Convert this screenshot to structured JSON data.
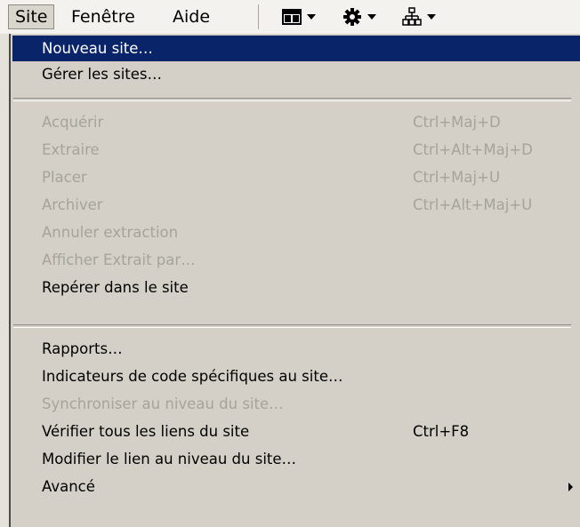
{
  "menubar": {
    "items": [
      "Site",
      "Fenêtre",
      "Aide"
    ]
  },
  "toolbar": {
    "icons": [
      "layout-icon",
      "gear-icon",
      "site-map-icon"
    ]
  },
  "menu": {
    "items": [
      {
        "label": "Nouveau site…",
        "shortcut": "",
        "state": "highlighted"
      },
      {
        "label": "Gérer les sites…",
        "shortcut": "",
        "state": "enabled"
      },
      {
        "label": "Acquérir",
        "shortcut": "Ctrl+Maj+D",
        "state": "disabled"
      },
      {
        "label": "Extraire",
        "shortcut": "Ctrl+Alt+Maj+D",
        "state": "disabled"
      },
      {
        "label": "Placer",
        "shortcut": "Ctrl+Maj+U",
        "state": "disabled"
      },
      {
        "label": "Archiver",
        "shortcut": "Ctrl+Alt+Maj+U",
        "state": "disabled"
      },
      {
        "label": "Annuler extraction",
        "shortcut": "",
        "state": "disabled"
      },
      {
        "label": "Afficher Extrait par…",
        "shortcut": "",
        "state": "disabled"
      },
      {
        "label": "Repérer dans le site",
        "shortcut": "",
        "state": "enabled"
      },
      {
        "label": "Rapports…",
        "shortcut": "",
        "state": "enabled"
      },
      {
        "label": "Indicateurs de code spécifiques au site…",
        "shortcut": "",
        "state": "enabled"
      },
      {
        "label": "Synchroniser au niveau du site…",
        "shortcut": "",
        "state": "disabled"
      },
      {
        "label": "Vérifier tous les liens du site",
        "shortcut": "Ctrl+F8",
        "state": "enabled"
      },
      {
        "label": "Modifier le lien au niveau du site…",
        "shortcut": "",
        "state": "enabled"
      },
      {
        "label": "Avancé",
        "shortcut": "",
        "state": "submenu"
      }
    ]
  }
}
